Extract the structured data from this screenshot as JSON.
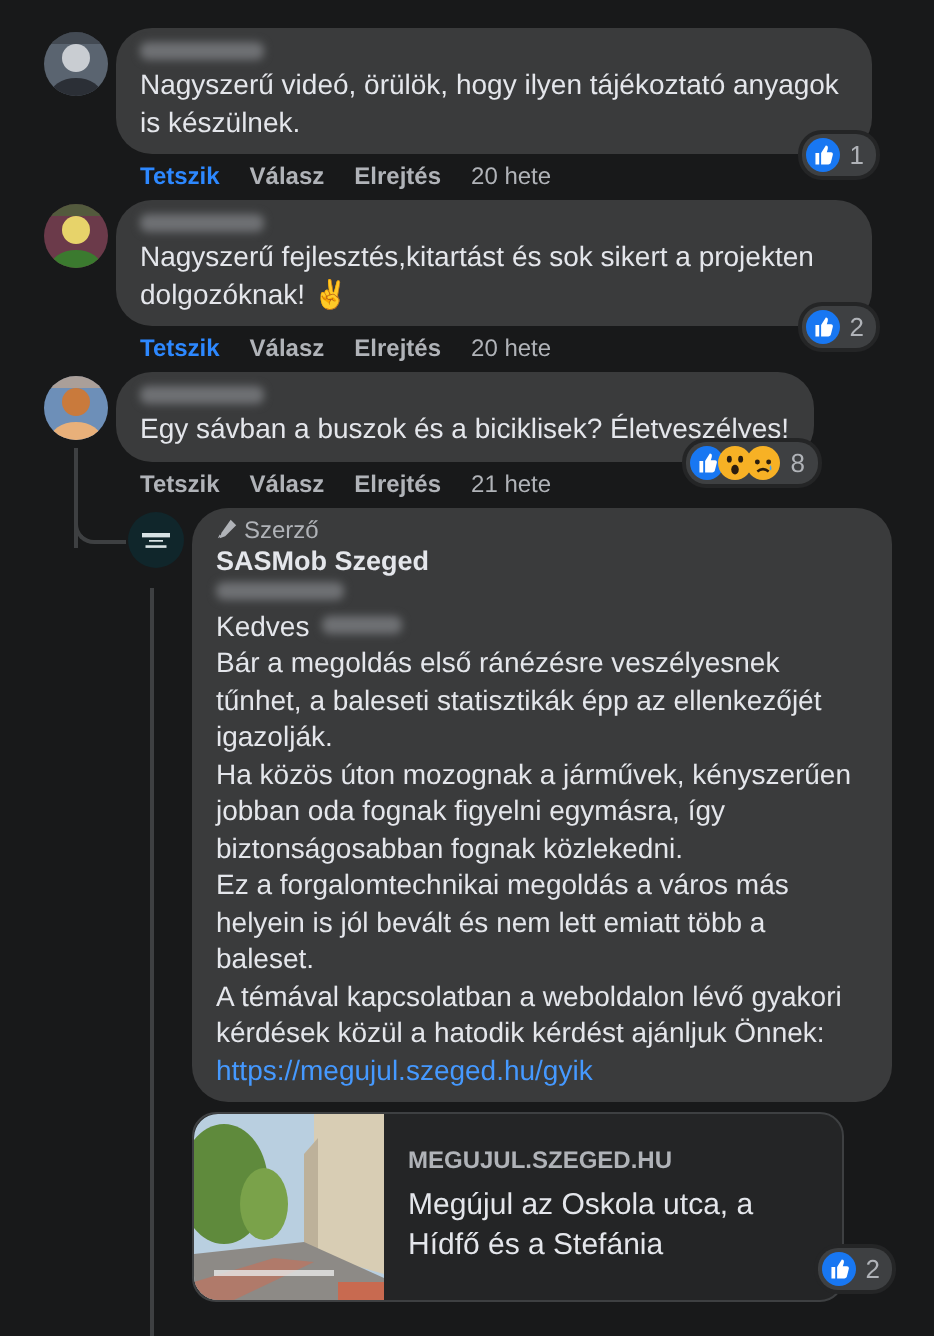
{
  "comments": [
    {
      "avatar": {
        "kind": "picture"
      },
      "text": "Nagyszerű videó, örülök, hogy ilyen tájékoztató anyagok is készülnek.",
      "reactions": {
        "types": [
          {
            "kind": "like"
          }
        ],
        "count": "1"
      },
      "actions": [
        {
          "label": "Tetszik",
          "selected": true
        },
        {
          "label": "Válasz",
          "selected": false
        },
        {
          "label": "Elrejtés",
          "selected": false
        }
      ],
      "time": "20 hete"
    },
    {
      "avatar": {
        "kind": "picture"
      },
      "text": "Nagyszerű fejlesztés,kitartást és sok sikert a projekten dolgozóknak! ✌️",
      "reactions": {
        "types": [
          {
            "kind": "like"
          }
        ],
        "count": "2"
      },
      "actions": [
        {
          "label": "Tetszik",
          "selected": true
        },
        {
          "label": "Válasz",
          "selected": false
        },
        {
          "label": "Elrejtés",
          "selected": false
        }
      ],
      "time": "20 hete"
    },
    {
      "avatar": {
        "kind": "picture"
      },
      "text": "Egy sávban a buszok és a biciklisek? Életveszélyes!",
      "reactions": {
        "types": [
          {
            "kind": "like"
          },
          {
            "kind": "wow"
          },
          {
            "kind": "sad"
          }
        ],
        "count": "8"
      },
      "actions": [
        {
          "label": "Tetszik",
          "selected": false
        },
        {
          "label": "Válasz",
          "selected": false
        },
        {
          "label": "Elrejtés",
          "selected": false
        }
      ],
      "time": "21 hete"
    }
  ],
  "reply": {
    "badge": "Szerző",
    "author": "SASMob Szeged",
    "greeting": "Kedves",
    "paragraphs": [
      "Bár a megoldás első ránézésre veszélyesnek tűnhet, a baleseti statisztikák épp az ellenkezőjét igazolják.",
      "Ha közös úton mozognak a járművek, kényszerűen jobban oda fognak figyelni egymásra, így biztonságosabban fognak közlekedni.",
      "Ez a forgalomtechnikai megoldás a város más helyein is jól bevált és nem lett emiatt több a baleset.",
      "A témával kapcsolatban a weboldalon lévő gyakori kérdések közül a hatodik kérdést ajánljuk Önnek:"
    ],
    "link": "https://megujul.szeged.hu/gyik",
    "preview": {
      "image": {
        "kind": "picture"
      },
      "domain": "MEGUJUL.SZEGED.HU",
      "title": "Megújul az Oskola utca, a Hídfő és a Stefánia"
    },
    "reactions": {
      "types": [
        {
          "kind": "like"
        }
      ],
      "count": "2"
    }
  }
}
